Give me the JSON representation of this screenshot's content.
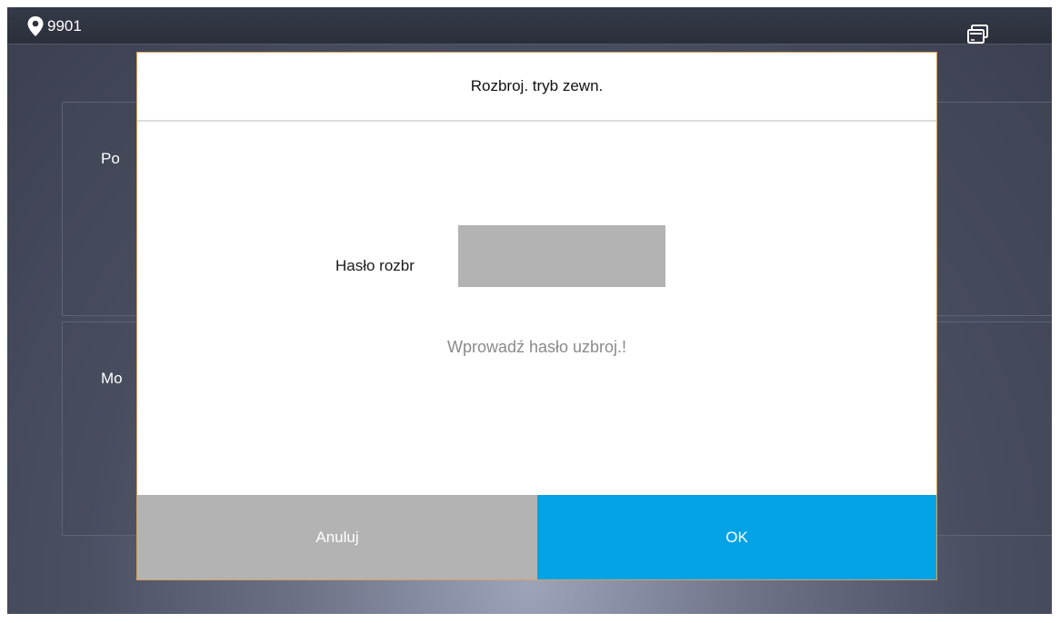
{
  "statusbar": {
    "location_icon": "location-pin-icon",
    "room_number": "9901",
    "screens_icon": "multi-screen-icon"
  },
  "background": {
    "card1_label": "Po",
    "card2_label": "Mo"
  },
  "dialog": {
    "title": "Rozbroj. tryb zewn.",
    "password_label": "Hasło rozbr",
    "password_value": "",
    "hint": "Wprowadź hasło uzbroj.!",
    "cancel_label": "Anuluj",
    "ok_label": "OK"
  },
  "colors": {
    "ok_button": "#03a3e6",
    "cancel_button": "#b3b3b3",
    "input_background": "#b3b3b3",
    "hint_text": "#8a8a8a"
  }
}
